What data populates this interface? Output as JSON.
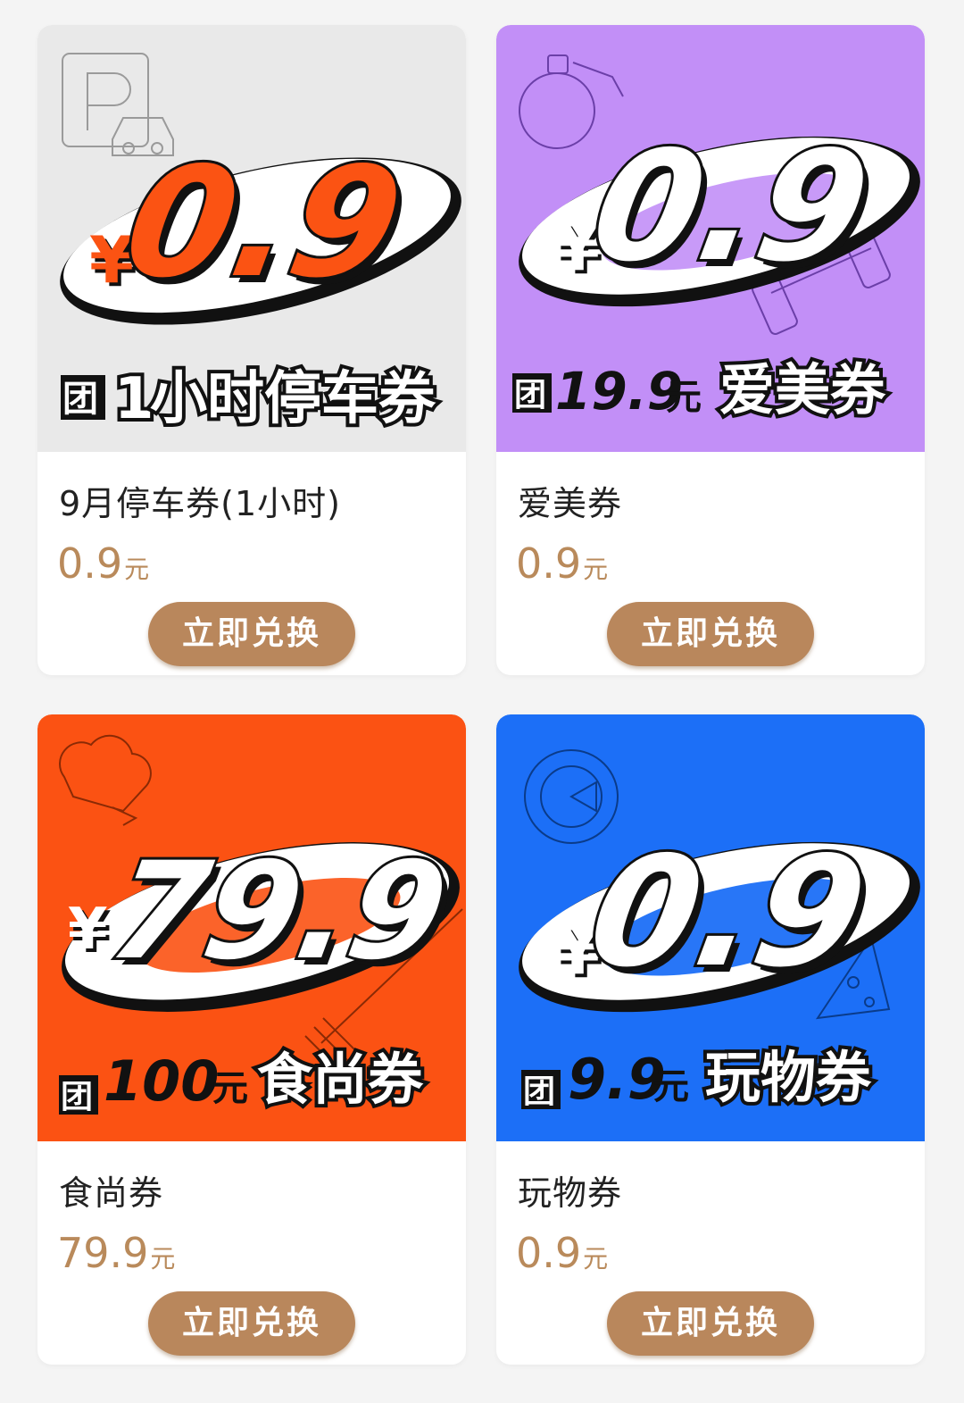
{
  "colors": {
    "price": "#b98a5b",
    "button": "#b9875c",
    "card_bg": "#ffffff",
    "page_bg": "#f4f4f4"
  },
  "cards": [
    {
      "banner_bg": "#e9e9e9",
      "banner_accent": "#fb5313",
      "banner_num_fill": "#fb5313",
      "banner_currency": "¥",
      "banner_price": "0.9",
      "banner_tuan": "团",
      "banner_amount": "1",
      "banner_unit": "",
      "banner_name": "小时停车券",
      "decor_icon": "parking-car-icon",
      "title": "9月停车券(1小时)",
      "price": "0.9",
      "unit": "元",
      "button_label": "立即兑换"
    },
    {
      "banner_bg": "#c28ff7",
      "banner_accent": "#ffffff",
      "banner_num_fill": "#ffffff",
      "banner_currency": "¥",
      "banner_price": "0.9",
      "banner_tuan": "团",
      "banner_amount": "19.9",
      "banner_unit": "元",
      "banner_name": "爱美券",
      "decor_icon": "perfume-dumbbell-icon",
      "title": "爱美券",
      "price": "0.9",
      "unit": "元",
      "button_label": "立即兑换"
    },
    {
      "banner_bg": "#fb5213",
      "banner_accent": "#ffffff",
      "banner_num_fill": "#ffffff",
      "banner_currency": "¥",
      "banner_price": "79.9",
      "banner_tuan": "团",
      "banner_amount": "100",
      "banner_unit": "元",
      "banner_name": "食尚券",
      "decor_icon": "chef-hat-fork-icon",
      "title": "食尚券",
      "price": "79.9",
      "unit": "元",
      "button_label": "立即兑换"
    },
    {
      "banner_bg": "#1c6ff7",
      "banner_accent": "#ffffff",
      "banner_num_fill": "#ffffff",
      "banner_currency": "¥",
      "banner_price": "0.9",
      "banner_tuan": "团",
      "banner_amount": "9.9",
      "banner_unit": "元",
      "banner_name": "玩物券",
      "decor_icon": "game-pizza-icon",
      "title": "玩物券",
      "price": "0.9",
      "unit": "元",
      "button_label": "立即兑换"
    }
  ]
}
